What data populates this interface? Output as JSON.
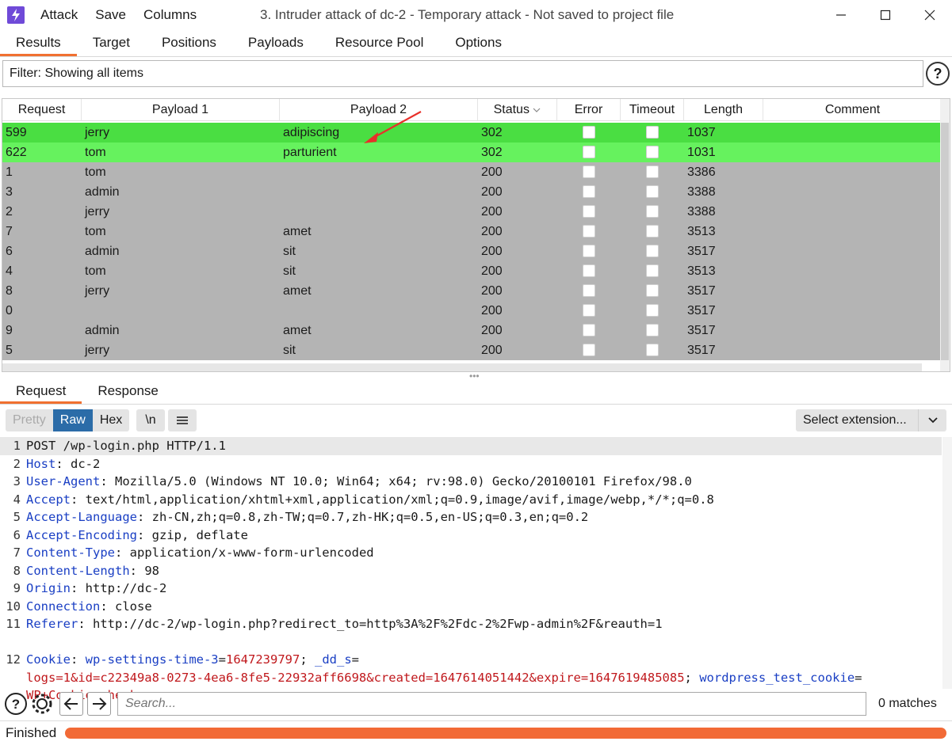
{
  "app": {
    "menu": [
      "Attack",
      "Save",
      "Columns"
    ],
    "window_title": "3. Intruder attack of dc-2 - Temporary attack - Not saved to project file"
  },
  "top_tabs": [
    "Results",
    "Target",
    "Positions",
    "Payloads",
    "Resource Pool",
    "Options"
  ],
  "filter": {
    "text": "Filter: Showing all items"
  },
  "table": {
    "columns": [
      "Request",
      "Payload 1",
      "Payload 2",
      "Status",
      "Error",
      "Timeout",
      "Length",
      "Comment"
    ],
    "rows": [
      {
        "request": "599",
        "payload1": "jerry",
        "payload2": "adipiscing",
        "status": "302",
        "length": "1037",
        "highlight": "#4ade42"
      },
      {
        "request": "622",
        "payload1": "tom",
        "payload2": "parturient",
        "status": "302",
        "length": "1031",
        "highlight": "#66f25e"
      },
      {
        "request": "1",
        "payload1": "tom",
        "payload2": "",
        "status": "200",
        "length": "3386",
        "highlight": ""
      },
      {
        "request": "3",
        "payload1": "admin",
        "payload2": "",
        "status": "200",
        "length": "3388",
        "highlight": ""
      },
      {
        "request": "2",
        "payload1": "jerry",
        "payload2": "",
        "status": "200",
        "length": "3388",
        "highlight": ""
      },
      {
        "request": "7",
        "payload1": "tom",
        "payload2": "amet",
        "status": "200",
        "length": "3513",
        "highlight": ""
      },
      {
        "request": "6",
        "payload1": "admin",
        "payload2": "sit",
        "status": "200",
        "length": "3517",
        "highlight": ""
      },
      {
        "request": "4",
        "payload1": "tom",
        "payload2": "sit",
        "status": "200",
        "length": "3513",
        "highlight": ""
      },
      {
        "request": "8",
        "payload1": "jerry",
        "payload2": "amet",
        "status": "200",
        "length": "3517",
        "highlight": ""
      },
      {
        "request": "0",
        "payload1": "",
        "payload2": "",
        "status": "200",
        "length": "3517",
        "highlight": ""
      },
      {
        "request": "9",
        "payload1": "admin",
        "payload2": "amet",
        "status": "200",
        "length": "3517",
        "highlight": ""
      },
      {
        "request": "5",
        "payload1": "jerry",
        "payload2": "sit",
        "status": "200",
        "length": "3517",
        "highlight": ""
      }
    ]
  },
  "lower_tabs": [
    "Request",
    "Response"
  ],
  "editor_toolbar": {
    "views": [
      "Pretty",
      "Raw",
      "Hex"
    ],
    "newline_label": "\\n",
    "select_extension": "Select extension..."
  },
  "request_lines": [
    {
      "n": "1",
      "key": "",
      "value": "POST /wp-login.php HTTP/1.1"
    },
    {
      "n": "2",
      "key": "Host",
      "value": "dc-2"
    },
    {
      "n": "3",
      "key": "User-Agent",
      "value": "Mozilla/5.0 (Windows NT 10.0; Win64; x64; rv:98.0) Gecko/20100101 Firefox/98.0"
    },
    {
      "n": "4",
      "key": "Accept",
      "value": "text/html,application/xhtml+xml,application/xml;q=0.9,image/avif,image/webp,*/*;q=0.8"
    },
    {
      "n": "5",
      "key": "Accept-Language",
      "value": "zh-CN,zh;q=0.8,zh-TW;q=0.7,zh-HK;q=0.5,en-US;q=0.3,en;q=0.2"
    },
    {
      "n": "6",
      "key": "Accept-Encoding",
      "value": "gzip, deflate"
    },
    {
      "n": "7",
      "key": "Content-Type",
      "value": "application/x-www-form-urlencoded"
    },
    {
      "n": "8",
      "key": "Content-Length",
      "value": "98"
    },
    {
      "n": "9",
      "key": "Origin",
      "value": "http://dc-2"
    },
    {
      "n": "10",
      "key": "Connection",
      "value": "close"
    },
    {
      "n": "11",
      "key": "Referer",
      "value": "http://dc-2/wp-login.php?redirect_to=http%3A%2F%2Fdc-2%2Fwp-admin%2F&reauth=1"
    }
  ],
  "cookie_line": {
    "n": "12",
    "key": "Cookie",
    "name1": "wp-settings-time-3",
    "value1": "1647239797",
    "name2": "_dd_s",
    "value2": "logs=1&id=c22349a8-0273-4ea6-8fe5-22932aff6698&created=1647614051442&expire=1647619485085",
    "name3": "wordpress_test_cookie",
    "value3": "WP+Cookie+check"
  },
  "search": {
    "placeholder": "Search...",
    "matches": "0 matches"
  },
  "status": {
    "text": "Finished",
    "progress": 1.0,
    "color": "#f26a36"
  },
  "colors": {
    "accent": "#f07030",
    "raw_active": "#2b6ca8",
    "row_default": "#b4b4b4"
  }
}
